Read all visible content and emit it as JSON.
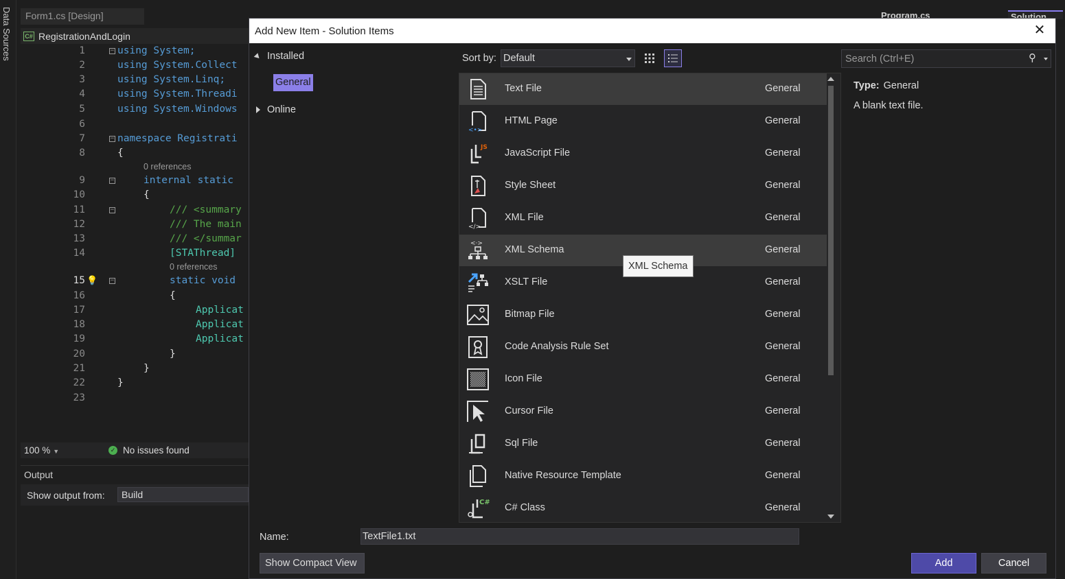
{
  "ide": {
    "data_sources_label": "Data Sources",
    "doc_tab": "Form1.cs [Design]",
    "right_tab_1": "Program.cs",
    "right_tab_2": "Solution Exp",
    "project_name": "RegistrationAndLogin",
    "code_lines": [
      {
        "n": "1",
        "text": "using System;"
      },
      {
        "n": "2",
        "text": "using System.Collect"
      },
      {
        "n": "3",
        "text": "using System.Linq;"
      },
      {
        "n": "4",
        "text": "using System.Threadi"
      },
      {
        "n": "5",
        "text": "using System.Windows"
      },
      {
        "n": "6",
        "text": ""
      },
      {
        "n": "7",
        "text": "namespace Registrati"
      },
      {
        "n": "8",
        "text": "{"
      },
      {
        "n": "9",
        "text": "internal static"
      },
      {
        "n": "10",
        "text": "{"
      },
      {
        "n": "11",
        "text": "/// <summary"
      },
      {
        "n": "12",
        "text": "/// The main"
      },
      {
        "n": "13",
        "text": "/// </summar"
      },
      {
        "n": "14",
        "text": "[STAThread]"
      },
      {
        "n": "15",
        "text": "static void"
      },
      {
        "n": "16",
        "text": "{"
      },
      {
        "n": "17",
        "text": "Applicat"
      },
      {
        "n": "18",
        "text": "Applicat"
      },
      {
        "n": "19",
        "text": "Applicat"
      },
      {
        "n": "20",
        "text": "}"
      },
      {
        "n": "21",
        "text": "}"
      },
      {
        "n": "22",
        "text": "}"
      },
      {
        "n": "23",
        "text": ""
      }
    ],
    "codelens_1": "0 references",
    "codelens_2": "0 references",
    "zoom": "100 %",
    "issues": "No issues found",
    "output_title": "Output",
    "output_from_label": "Show output from:",
    "output_from_value": "Build"
  },
  "dialog": {
    "title": "Add New Item - Solution Items",
    "close_glyph": "✕",
    "tree": {
      "installed": "Installed",
      "general": "General",
      "online": "Online"
    },
    "sort_label": "Sort by:",
    "sort_value": "Default",
    "search_placeholder": "Search (Ctrl+E)",
    "items": [
      {
        "name": "Text File",
        "category": "General",
        "icon": "text-file-icon"
      },
      {
        "name": "HTML Page",
        "category": "General",
        "icon": "html-page-icon"
      },
      {
        "name": "JavaScript File",
        "category": "General",
        "icon": "javascript-file-icon"
      },
      {
        "name": "Style Sheet",
        "category": "General",
        "icon": "style-sheet-icon"
      },
      {
        "name": "XML File",
        "category": "General",
        "icon": "xml-file-icon"
      },
      {
        "name": "XML Schema",
        "category": "General",
        "icon": "xml-schema-icon"
      },
      {
        "name": "XSLT File",
        "category": "General",
        "icon": "xslt-file-icon"
      },
      {
        "name": "Bitmap File",
        "category": "General",
        "icon": "bitmap-file-icon"
      },
      {
        "name": "Code Analysis Rule Set",
        "category": "General",
        "icon": "rule-set-icon"
      },
      {
        "name": "Icon File",
        "category": "General",
        "icon": "icon-file-icon"
      },
      {
        "name": "Cursor File",
        "category": "General",
        "icon": "cursor-file-icon"
      },
      {
        "name": "Sql File",
        "category": "General",
        "icon": "sql-file-icon"
      },
      {
        "name": "Native Resource Template",
        "category": "General",
        "icon": "native-resource-icon"
      },
      {
        "name": "C# Class",
        "category": "General",
        "icon": "csharp-class-icon"
      }
    ],
    "tooltip": "XML Schema",
    "details": {
      "type_label": "Type:",
      "type_value": "General",
      "description": "A blank text file."
    },
    "name_label": "Name:",
    "name_value": "TextFile1.txt",
    "compact_view_button": "Show Compact View",
    "add_button": "Add",
    "cancel_button": "Cancel"
  }
}
